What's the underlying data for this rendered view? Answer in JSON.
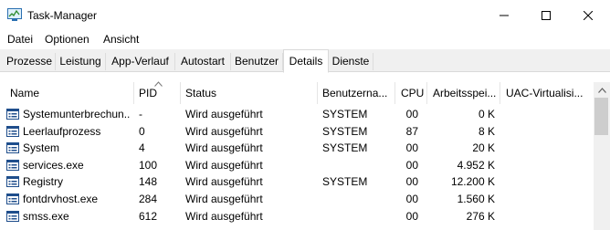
{
  "window": {
    "title": "Task-Manager",
    "icon": "task-manager-icon",
    "controls": [
      "minimize-icon",
      "maximize-icon",
      "close-icon"
    ]
  },
  "menu": [
    {
      "label": "Datei"
    },
    {
      "label": "Optionen"
    },
    {
      "label": "Ansicht"
    }
  ],
  "tabs": [
    {
      "label": "Prozesse"
    },
    {
      "label": "Leistung"
    },
    {
      "label": "App-Verlauf"
    },
    {
      "label": "Autostart"
    },
    {
      "label": "Benutzer"
    },
    {
      "label": "Details",
      "active": true
    },
    {
      "label": "Dienste"
    }
  ],
  "columns": [
    {
      "key": "name",
      "label": "Name"
    },
    {
      "key": "pid",
      "label": "PID",
      "sorted": true
    },
    {
      "key": "status",
      "label": "Status"
    },
    {
      "key": "user",
      "label": "Benutzerna..."
    },
    {
      "key": "cpu",
      "label": "CPU"
    },
    {
      "key": "memory",
      "label": "Arbeitsspei..."
    },
    {
      "key": "uac",
      "label": "UAC-Virtualisi..."
    }
  ],
  "rows": [
    {
      "name": "Systemunterbrechun...",
      "pid": "-",
      "status": "Wird ausgeführt",
      "user": "SYSTEM",
      "cpu": "00",
      "memory": "0 K",
      "uac": ""
    },
    {
      "name": "Leerlaufprozess",
      "pid": "0",
      "status": "Wird ausgeführt",
      "user": "SYSTEM",
      "cpu": "87",
      "memory": "8 K",
      "uac": ""
    },
    {
      "name": "System",
      "pid": "4",
      "status": "Wird ausgeführt",
      "user": "SYSTEM",
      "cpu": "00",
      "memory": "20 K",
      "uac": ""
    },
    {
      "name": "services.exe",
      "pid": "100",
      "status": "Wird ausgeführt",
      "user": "",
      "cpu": "00",
      "memory": "4.952 K",
      "uac": ""
    },
    {
      "name": "Registry",
      "pid": "148",
      "status": "Wird ausgeführt",
      "user": "SYSTEM",
      "cpu": "00",
      "memory": "12.200 K",
      "uac": ""
    },
    {
      "name": "fontdrvhost.exe",
      "pid": "284",
      "status": "Wird ausgeführt",
      "user": "",
      "cpu": "00",
      "memory": "1.560 K",
      "uac": ""
    },
    {
      "name": "smss.exe",
      "pid": "612",
      "status": "Wird ausgeführt",
      "user": "",
      "cpu": "00",
      "memory": "276 K",
      "uac": ""
    }
  ]
}
